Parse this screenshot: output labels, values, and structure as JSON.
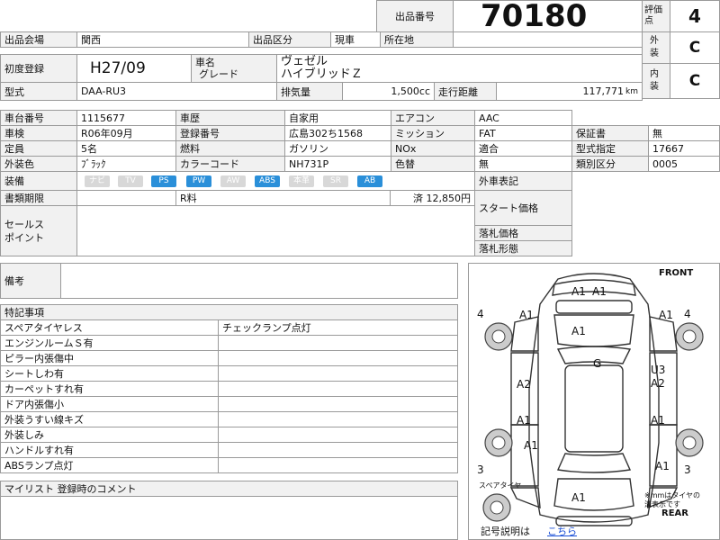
{
  "header": {
    "lot_label": "出品番号",
    "lot_number": "70180",
    "score_label": "評価点",
    "score_value": "4",
    "exterior_label": "外装",
    "exterior_value": "C",
    "interior_label": "内装",
    "interior_value": "C"
  },
  "row_venue": {
    "venue_label": "出品会場",
    "venue_value": "関西",
    "category_label": "出品区分",
    "category_value": "現車",
    "location_label": "所在地",
    "location_value": ""
  },
  "vehicle": {
    "first_reg_label": "初度登録",
    "first_reg_value": "H27/09",
    "name_label": "車名",
    "grade_label": "グレード",
    "name_value": "ヴェゼル",
    "grade_value": "ハイブリッドＺ",
    "model_label": "型式",
    "model_value": "DAA-RU3",
    "displacement_label": "排気量",
    "displacement_value": "1,500cc",
    "mileage_label": "走行距離",
    "mileage_value": "117,771",
    "mileage_unit": "km"
  },
  "details": {
    "chassis_label": "車台番号",
    "chassis_value": "1115677",
    "history_label": "車歴",
    "history_value": "自家用",
    "aircon_label": "エアコン",
    "aircon_value": "AAC",
    "inspection_label": "車検",
    "inspection_value": "R06年09月",
    "plate_label": "登録番号",
    "plate_value": "広島302ち1568",
    "mission_label": "ミッション",
    "mission_value": "FAT",
    "warranty_label": "保証書",
    "warranty_value": "無",
    "capacity_label": "定員",
    "capacity_value": "5名",
    "fuel_label": "燃料",
    "fuel_value": "ガソリン",
    "nox_label": "NOx",
    "nox_value": "適合",
    "type_designation_label": "型式指定",
    "type_designation_value": "17667",
    "color_label": "外装色",
    "color_value": "ﾌﾞﾗｯｸ",
    "color_code_label": "カラーコード",
    "color_code_value": "NH731P",
    "repaint_label": "色替",
    "repaint_value": "無",
    "class_label": "類別区分",
    "class_value": "0005",
    "equipment_label": "装備",
    "equipment": [
      {
        "label": "ナビ",
        "on": false
      },
      {
        "label": "TV",
        "on": false
      },
      {
        "label": "PS",
        "on": true
      },
      {
        "label": "PW",
        "on": true
      },
      {
        "label": "AW",
        "on": false
      },
      {
        "label": "ABS",
        "on": true
      },
      {
        "label": "本革",
        "on": false
      },
      {
        "label": "SR",
        "on": false
      },
      {
        "label": "AB",
        "on": true
      }
    ],
    "outer_mark_label": "外車表記",
    "docs_deadline_label": "書類期限",
    "r_fee_label": "R料",
    "r_fee_value": "済 12,850円",
    "start_price_label": "スタート価格",
    "sales_point_label": "セールス\nポイント",
    "bid_price_label": "落札価格",
    "bid_form_label": "落札形態"
  },
  "notes": {
    "remarks_label": "備考",
    "special_label": "特記事項",
    "items_left": [
      "スペアタイヤレス",
      "エンジンルームＳ有",
      "ピラー内張傷中",
      "シートしわ有",
      "カーペットすれ有",
      "ドア内張傷小",
      "外装うすい線キズ",
      "外装しみ",
      "ハンドルすれ有",
      "ABSランプ点灯"
    ],
    "items_right": [
      "チェックランプ点灯"
    ],
    "mylist_label": "マイリスト 登録時のコメント"
  },
  "diagram": {
    "front_label": "FRONT",
    "rear_label": "REAR",
    "spare_label": "スペアタイヤ",
    "tire_note": "※mmはタイヤの\n溝表示です",
    "tire_depth_fl": "4",
    "tire_depth_fr": "4",
    "tire_depth_rl": "3",
    "tire_depth_rr": "3",
    "marks": {
      "front_bumper_1": "A1",
      "front_bumper_2": "A1",
      "hood": "A1",
      "front_left_fender": "A1",
      "roof": "G",
      "front_left_door": "A2",
      "rear_left_door": "A1",
      "rear_left_fender": "A1",
      "front_right_fender": "A1",
      "front_right_door_1": "U3",
      "front_right_door_2": "A2",
      "rear_right_door": "A1",
      "rear_right_fender": "A1",
      "rear_bumper": "A1"
    },
    "legend_label": "記号説明は",
    "legend_link": "こちら"
  },
  "colors": {
    "equip_on": "#2a8fd9",
    "equip_off": "#d8d8d8",
    "link": "#1a4fd6"
  }
}
